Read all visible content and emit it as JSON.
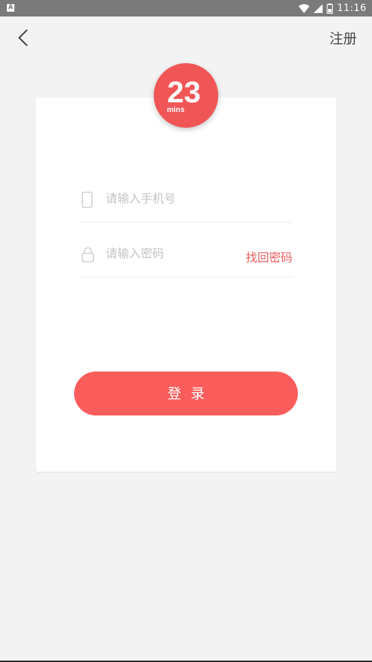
{
  "status_bar": {
    "time": "11:16",
    "left_icon": "A",
    "icons": [
      "wifi-icon",
      "cell-signal-icon",
      "battery-icon"
    ]
  },
  "header": {
    "back_icon": "chevron-left-icon",
    "register_label": "注册"
  },
  "logo": {
    "text_main": "23",
    "text_sub": "mins",
    "color": "#f05656"
  },
  "form": {
    "phone": {
      "placeholder": "请输入手机号",
      "value": "",
      "icon": "phone-icon"
    },
    "password": {
      "placeholder": "请输入密码",
      "value": "",
      "icon": "lock-icon"
    },
    "forgot_label": "找回密码",
    "login_label": "登录"
  },
  "colors": {
    "accent": "#fb5d5d",
    "background": "#f3f3f3",
    "status_bar": "#7a7a7a"
  }
}
